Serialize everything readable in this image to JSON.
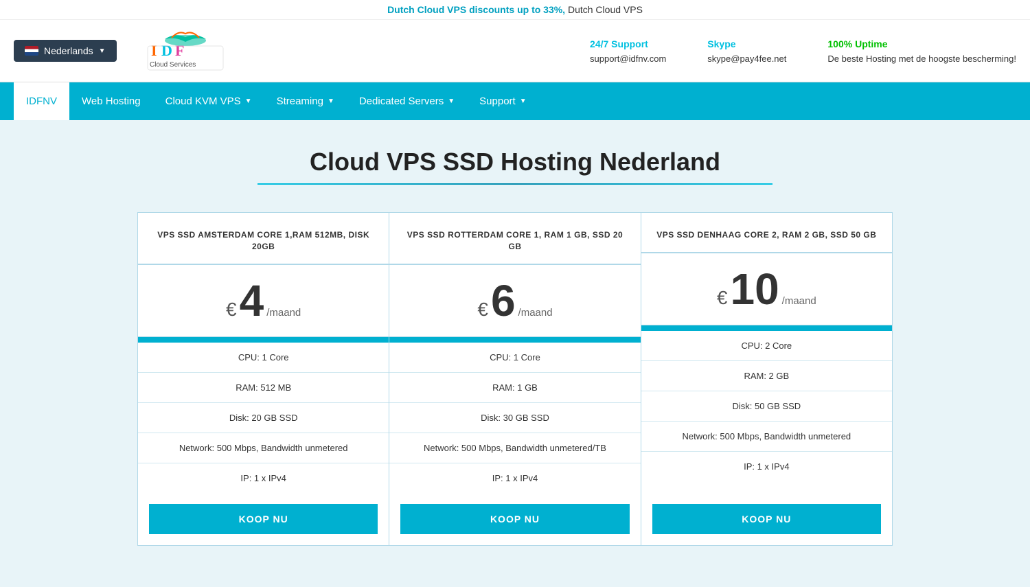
{
  "topBanner": {
    "discountText": "Dutch Cloud VPS discounts up to 33%,",
    "discountTextNormal": "Dutch Cloud VPS"
  },
  "langSelector": {
    "label": "Nederlands"
  },
  "logo": {
    "alt": "IDF Cloud Services"
  },
  "support": {
    "support247": {
      "label": "24/7 Support",
      "value": "support@idfnv.com"
    },
    "skype": {
      "label": "Skype",
      "value": "skype@pay4fee.net"
    },
    "uptime": {
      "label": "100% Uptime",
      "value": "De beste Hosting met de hoogste bescherming!"
    }
  },
  "nav": {
    "items": [
      {
        "id": "idfnv",
        "label": "IDFNV",
        "active": true,
        "hasDropdown": false
      },
      {
        "id": "web-hosting",
        "label": "Web Hosting",
        "active": false,
        "hasDropdown": false
      },
      {
        "id": "cloud-kvm-vps",
        "label": "Cloud KVM VPS",
        "active": false,
        "hasDropdown": true
      },
      {
        "id": "streaming",
        "label": "Streaming",
        "active": false,
        "hasDropdown": true
      },
      {
        "id": "dedicated-servers",
        "label": "Dedicated Servers",
        "active": false,
        "hasDropdown": true
      },
      {
        "id": "support",
        "label": "Support",
        "active": false,
        "hasDropdown": true
      }
    ]
  },
  "page": {
    "title": "Cloud VPS SSD Hosting Nederland"
  },
  "cards": [
    {
      "id": "card-amsterdam",
      "title": "VPS SSD AMSTERDAM CORE 1,RAM 512MB, DISK 20GB",
      "price": "4",
      "perMonth": "/maand",
      "specs": [
        {
          "label": "CPU: 1 Core"
        },
        {
          "label": "RAM: 512 MB"
        },
        {
          "label": "Disk: 20 GB SSD"
        },
        {
          "label": "Network: 500 Mbps, Bandwidth unmetered"
        },
        {
          "label": "IP: 1 x IPv4"
        }
      ],
      "btnLabel": "KOOP NU"
    },
    {
      "id": "card-rotterdam",
      "title": "VPS SSD ROTTERDAM CORE 1, RAM 1 GB, SSD 20 GB",
      "price": "6",
      "perMonth": "/maand",
      "specs": [
        {
          "label": "CPU: 1 Core"
        },
        {
          "label": "RAM: 1 GB"
        },
        {
          "label": "Disk: 30 GB SSD"
        },
        {
          "label": "Network: 500 Mbps, Bandwidth unmetered/TB"
        },
        {
          "label": "IP: 1 x IPv4"
        }
      ],
      "btnLabel": "KOOP NU"
    },
    {
      "id": "card-denhaag",
      "title": "VPS SSD DENHAAG CORE 2, RAM 2 GB, SSD 50 GB",
      "price": "10",
      "perMonth": "/maand",
      "specs": [
        {
          "label": "CPU: 2 Core"
        },
        {
          "label": "RAM: 2 GB"
        },
        {
          "label": "Disk: 50 GB SSD"
        },
        {
          "label": "Network: 500 Mbps, Bandwidth unmetered"
        },
        {
          "label": "IP: 1 x IPv4"
        }
      ],
      "btnLabel": "KOOP NU"
    }
  ]
}
